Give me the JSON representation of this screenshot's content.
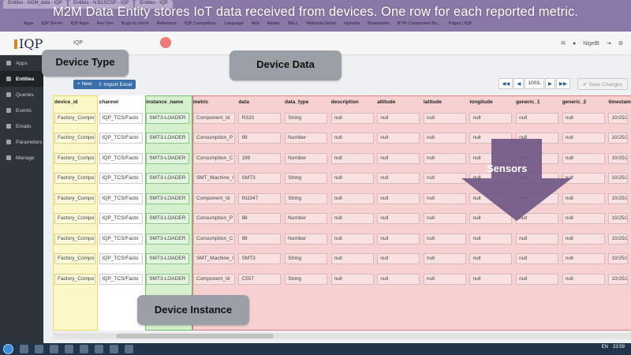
{
  "browser": {
    "tabs": [
      "Entities - M2M_data - IQP",
      "Entities - N.B1SCSP - IQP",
      "Entities - IQP"
    ],
    "bookmarks": [
      "Apps",
      "IQP Server",
      "IQP Apps",
      "Rev Dev",
      "Bugs to check",
      "Reference",
      "IQP Competitors",
      "Language",
      "Ada",
      "Adobe",
      "DELL",
      "Motorola Demo",
      "Hypedia",
      "Bookmarks",
      "BTW Component Bo...",
      "Pages | IQP"
    ]
  },
  "caption": "M2M Data Entity stores IoT data received from devices. One row for each reported metric.",
  "header": {
    "logo_text": "IQP",
    "breadcrumb": "IQP",
    "user": "NigelB"
  },
  "sidebar": {
    "items": [
      {
        "label": "Apps",
        "icon": "apps-icon"
      },
      {
        "label": "Entities",
        "icon": "entities-icon",
        "active": true
      },
      {
        "label": "Queries",
        "icon": "queries-icon"
      },
      {
        "label": "Events",
        "icon": "events-icon"
      },
      {
        "label": "Emails",
        "icon": "emails-icon"
      },
      {
        "label": "Parameters",
        "icon": "parameters-icon"
      },
      {
        "label": "Manage",
        "icon": "manage-icon"
      }
    ]
  },
  "toolbar": {
    "new_label": "New",
    "import_label": "Import Excel",
    "pager": {
      "first": "◀◀",
      "prev": "◀",
      "page": "1003-",
      "next": "▶",
      "last": "▶▶"
    },
    "save_label": "Save Changes"
  },
  "table": {
    "columns": [
      "device_id",
      "channel",
      "instance_name",
      "metric",
      "data",
      "data_type",
      "description",
      "altitude",
      "latitude",
      "longitude",
      "generic_1",
      "generic_2",
      "timestam"
    ],
    "rows": [
      [
        "Factory_Compo",
        "IQP_TCS/Facto",
        "SMT3-LOADER",
        "Component_Id",
        "R333",
        "String",
        "null",
        "null",
        "null",
        "null",
        "null",
        "null",
        "10/25/2"
      ],
      [
        "Factory_Compo",
        "IQP_TCS/Facto",
        "SMT3-LOADER",
        "Consumption_P",
        "99",
        "Number",
        "null",
        "null",
        "null",
        "null",
        "null",
        "null",
        "10/25/2"
      ],
      [
        "Factory_Compo",
        "IQP_TCS/Facto",
        "SMT3-LOADER",
        "Consumption_C",
        "199",
        "Number",
        "null",
        "null",
        "null",
        "null",
        "null",
        "null",
        "10/25/2"
      ],
      [
        "Factory_Compo",
        "IQP_TCS/Facto",
        "SMT3-LOADER",
        "SMT_Machine_I",
        "SMT3",
        "String",
        "null",
        "null",
        "null",
        "null",
        "null",
        "null",
        "10/25/2"
      ],
      [
        "Factory_Compo",
        "IQP_TCS/Facto",
        "SMT3-LOADER",
        "Component_Id",
        "IN3347",
        "String",
        "null",
        "null",
        "null",
        "null",
        "null",
        "null",
        "10/25/2"
      ],
      [
        "Factory_Compo",
        "IQP_TCS/Facto",
        "SMT3-LOADER",
        "Consumption_P",
        "98",
        "Number",
        "null",
        "null",
        "null",
        "null",
        "null",
        "null",
        "10/25/2"
      ],
      [
        "Factory_Compo",
        "IQP_TCS/Facto",
        "SMT3-LOADER",
        "Consumption_C",
        "98",
        "Number",
        "null",
        "null",
        "null",
        "null",
        "null",
        "null",
        "10/25/2"
      ],
      [
        "Factory_Compo",
        "IQP_TCS/Facto",
        "SMT3-LOADER",
        "SMT_Machine_I",
        "SMT3",
        "String",
        "null",
        "null",
        "null",
        "null",
        "null",
        "null",
        "10/25/2"
      ],
      [
        "Factory_Compo",
        "IQP_TCS/Facto",
        "SMT3-LOADER",
        "Component_Id",
        "C557",
        "String",
        "null",
        "null",
        "null",
        "null",
        "null",
        "null",
        "10/25/2"
      ]
    ]
  },
  "annotations": {
    "device_type": "Device Type",
    "device_data": "Device Data",
    "device_instance": "Device Instance",
    "sensors": "Sensors"
  },
  "taskbar": {
    "lang": "EN",
    "time": "23:59"
  },
  "colors": {
    "device_type_highlight": "#fbf7c6",
    "instance_highlight": "#d5efcf",
    "data_highlight": "#f7d1d1",
    "caption_bar": "#8a78a8",
    "arrow": "#6b5584"
  }
}
